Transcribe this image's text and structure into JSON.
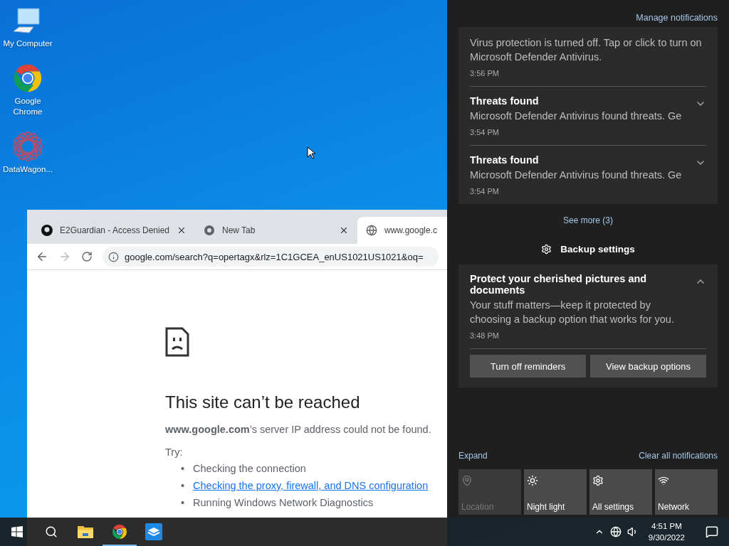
{
  "desktop_icons": [
    {
      "label": "My Computer",
      "kind": "computer"
    },
    {
      "label": "Google Chrome",
      "kind": "chrome"
    },
    {
      "label": "DataWagon...",
      "kind": "datawagon"
    }
  ],
  "browser": {
    "tabs": [
      {
        "title": "E2Guardian - Access Denied",
        "kind": "github",
        "selected": false
      },
      {
        "title": "New Tab",
        "kind": "chrome",
        "selected": false
      },
      {
        "title": "www.google.c",
        "kind": "globe",
        "selected": true
      }
    ],
    "address": "google.com/search?q=opertagx&rlz=1C1GCEA_enUS1021US1021&oq=",
    "page": {
      "heading": "This site can’t be reached",
      "message": "**www.google.com**’s server IP address could not be found.",
      "try_label": "Try:",
      "bullet": "•",
      "suggestions": [
        {
          "text": "Checking the connection",
          "kind": "text"
        },
        {
          "text": "Checking the proxy, firewall, and DNS configuration",
          "kind": "link"
        },
        {
          "text": "Running Windows Network Diagnostics",
          "kind": "text"
        }
      ]
    }
  },
  "action_center": {
    "manage": "Manage notifications",
    "defender_group": {
      "notifications": [
        {
          "body": "Virus protection is turned off. Tap or click to turn on Microsoft Defender Antivirus.",
          "time": "3:56 PM"
        },
        {
          "title": "Threats found",
          "body": "Microsoft Defender Antivirus found threats. Ge",
          "time": "3:54 PM",
          "expanded": false
        },
        {
          "title": "Threats found",
          "body": "Microsoft Defender Antivirus found threats. Ge",
          "time": "3:54 PM",
          "expanded": false
        }
      ],
      "see_more": "See more (3)"
    },
    "backup_group": {
      "header": "Backup settings",
      "notification": {
        "title": "Protect your cherished pictures and documents",
        "body": "Your stuff matters—keep it protected by choosing a backup option that works for you.",
        "time": "3:48 PM",
        "expanded": true,
        "buttons": [
          "Turn off reminders",
          "View backup options"
        ]
      }
    },
    "expand": "Expand",
    "clear_all": "Clear all notifications",
    "quick_actions": [
      {
        "label": "Location",
        "kind": "location",
        "disabled": true
      },
      {
        "label": "Night light",
        "kind": "nightlight",
        "disabled": false
      },
      {
        "label": "All settings",
        "kind": "settings",
        "disabled": false
      },
      {
        "label": "Network",
        "kind": "network",
        "disabled": false
      }
    ]
  },
  "taskbar": {
    "apps": [
      {
        "kind": "explorer",
        "running": false
      },
      {
        "kind": "chrome",
        "running": true
      },
      {
        "kind": "sandbox",
        "running": false
      }
    ],
    "time": "4:51 PM",
    "date": "9/30/2022"
  }
}
